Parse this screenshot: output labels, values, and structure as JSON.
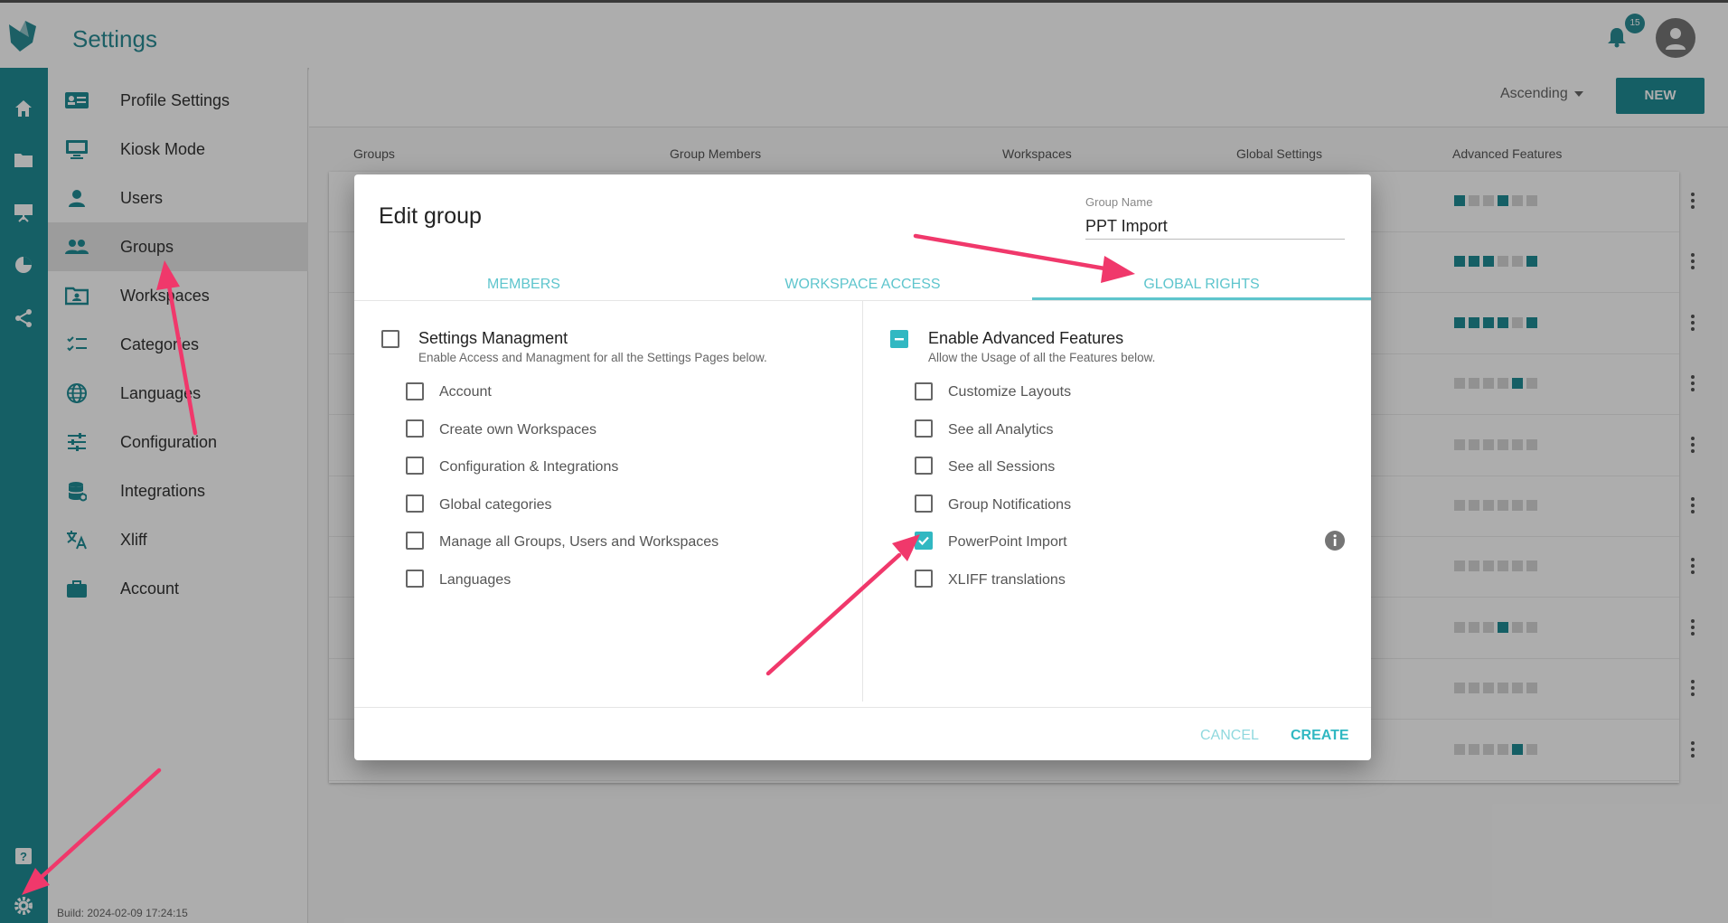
{
  "app": {
    "title": "Settings",
    "notification_count": "15",
    "build": "Build: 2024-02-09 17:24:15"
  },
  "rail": {
    "icons": [
      "home-icon",
      "folder-icon",
      "presentation-icon",
      "pie-chart-icon",
      "share-icon",
      "help-icon",
      "gear-icon"
    ]
  },
  "sidebar": {
    "items": [
      {
        "label": "Profile Settings",
        "icon": "id-card-icon"
      },
      {
        "label": "Kiosk Mode",
        "icon": "monitor-icon"
      },
      {
        "label": "Users",
        "icon": "person-icon"
      },
      {
        "label": "Groups",
        "icon": "people-icon"
      },
      {
        "label": "Workspaces",
        "icon": "workspace-folder-icon"
      },
      {
        "label": "Categories",
        "icon": "checklist-icon"
      },
      {
        "label": "Languages",
        "icon": "globe-icon"
      },
      {
        "label": "Configuration",
        "icon": "sliders-icon"
      },
      {
        "label": "Integrations",
        "icon": "database-icon"
      },
      {
        "label": "Xliff",
        "icon": "translate-icon"
      },
      {
        "label": "Account",
        "icon": "briefcase-icon"
      }
    ],
    "active": "Groups"
  },
  "toolbar": {
    "sort_label": "Ascending",
    "new_label": "NEW"
  },
  "table": {
    "columns": [
      "Groups",
      "Group Members",
      "Workspaces",
      "Global Settings",
      "Advanced Features"
    ],
    "advanced_features_rows": [
      [
        1,
        0,
        0,
        1,
        0,
        0
      ],
      [
        1,
        1,
        1,
        0,
        0,
        1
      ],
      [
        1,
        1,
        1,
        1,
        0,
        1
      ],
      [
        0,
        0,
        0,
        0,
        1,
        0
      ],
      [
        0,
        0,
        0,
        0,
        0,
        0
      ],
      [
        0,
        0,
        0,
        0,
        0,
        0
      ],
      [
        0,
        0,
        0,
        0,
        0,
        0
      ],
      [
        0,
        0,
        0,
        1,
        0,
        0
      ],
      [
        0,
        0,
        0,
        0,
        0,
        0
      ],
      [
        0,
        0,
        0,
        0,
        1,
        0
      ]
    ]
  },
  "modal": {
    "title": "Edit group",
    "group_name_label": "Group Name",
    "group_name_value": "PPT Import",
    "tabs": [
      "MEMBERS",
      "WORKSPACE ACCESS",
      "GLOBAL RIGHTS"
    ],
    "active_tab": "GLOBAL RIGHTS",
    "settings": {
      "title": "Settings Managment",
      "subtitle": "Enable Access and Managment for all the Settings Pages below.",
      "checked": false,
      "options": [
        {
          "label": "Account",
          "checked": false
        },
        {
          "label": "Create own Workspaces",
          "checked": false
        },
        {
          "label": "Configuration & Integrations",
          "checked": false
        },
        {
          "label": "Global categories",
          "checked": false
        },
        {
          "label": "Manage all Groups, Users and Workspaces",
          "checked": false
        },
        {
          "label": "Languages",
          "checked": false
        }
      ]
    },
    "advanced": {
      "title": "Enable Advanced Features",
      "subtitle": "Allow the Usage of all the Features below.",
      "state": "indeterminate",
      "options": [
        {
          "label": "Customize Layouts",
          "checked": false
        },
        {
          "label": "See all Analytics",
          "checked": false
        },
        {
          "label": "See all Sessions",
          "checked": false
        },
        {
          "label": "Group Notifications",
          "checked": false
        },
        {
          "label": "PowerPoint Import",
          "checked": true
        },
        {
          "label": "XLIFF translations",
          "checked": false
        }
      ]
    },
    "cancel_label": "CANCEL",
    "create_label": "CREATE"
  },
  "colors": {
    "teal": "#1f8c96",
    "accent": "#31b8c2",
    "light_accent": "#5ec5cd",
    "arrow": "#f0386b"
  }
}
